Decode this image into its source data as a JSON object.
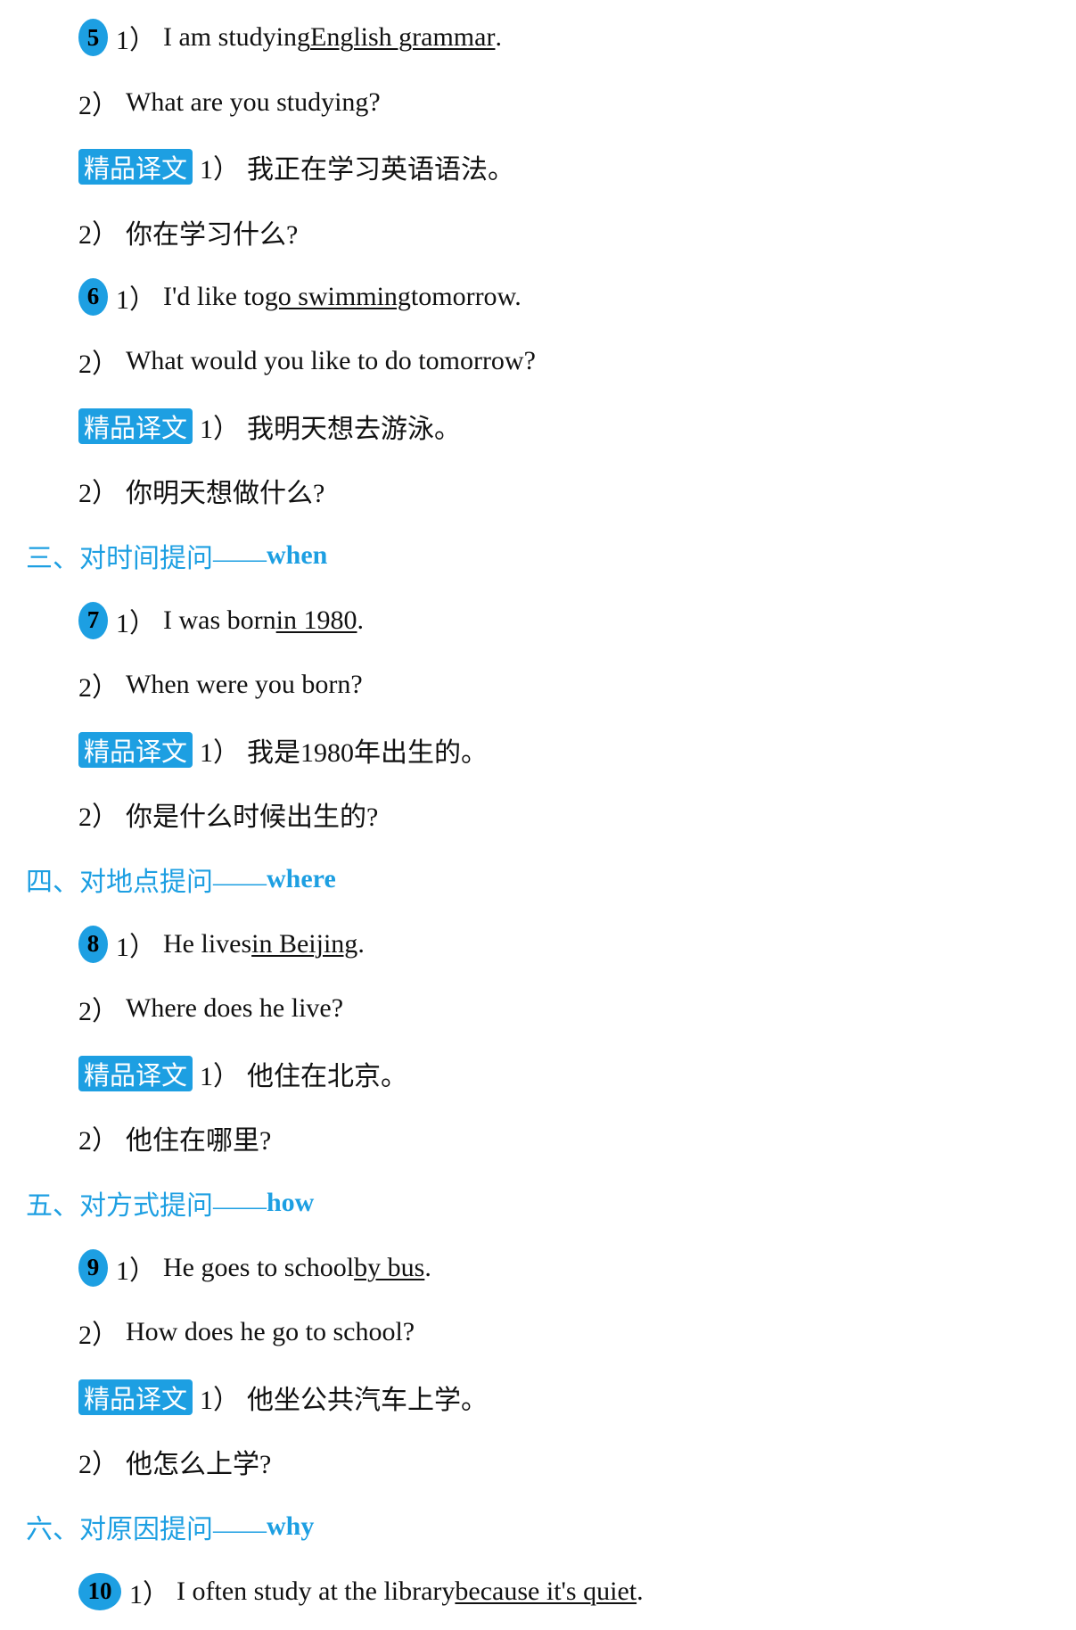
{
  "colors": {
    "accent": "#1d9fe2",
    "text": "#111111",
    "tag_text": "#ffffff"
  },
  "headings": [
    {
      "label": "三、对时间提问——",
      "keyword": "when"
    },
    {
      "label": "四、对地点提问——",
      "keyword": "where"
    },
    {
      "label": "五、对方式提问——",
      "keyword": "how"
    },
    {
      "label": "六、对原因提问——",
      "keyword": "why"
    }
  ],
  "items": [
    {
      "num": "5",
      "en1": {
        "prefix": "1）",
        "before": "I am studying ",
        "underline": "English grammar",
        "after": "."
      },
      "en2": {
        "prefix": "2）",
        "text": "What are you studying?"
      },
      "translation": {
        "tag": "精品译文",
        "zh1": {
          "prefix": "1）",
          "text": "我正在学习英语语法。"
        },
        "zh2": {
          "prefix": "2）",
          "text": "你在学习什么?"
        }
      }
    },
    {
      "num": "6",
      "en1": {
        "prefix": "1）",
        "before": "I'd like to ",
        "underline": "go swimming",
        "after": " tomorrow."
      },
      "en2": {
        "prefix": "2）",
        "text": "What would you like to do tomorrow?"
      },
      "translation": {
        "tag": "精品译文",
        "zh1": {
          "prefix": "1）",
          "text": "我明天想去游泳。"
        },
        "zh2": {
          "prefix": "2）",
          "text": "你明天想做什么?"
        }
      }
    },
    {
      "num": "7",
      "en1": {
        "prefix": "1）",
        "before": "I was born ",
        "underline": "in 1980",
        "after": "."
      },
      "en2": {
        "prefix": "2）",
        "text": "When were you born?"
      },
      "translation": {
        "tag": "精品译文",
        "zh1": {
          "prefix": "1）",
          "text": "我是1980年出生的。"
        },
        "zh2": {
          "prefix": "2）",
          "text": "你是什么时候出生的?"
        }
      }
    },
    {
      "num": "8",
      "en1": {
        "prefix": "1）",
        "before": "He lives ",
        "underline": "in Beijing",
        "after": "."
      },
      "en2": {
        "prefix": "2）",
        "text": "Where does he live?"
      },
      "translation": {
        "tag": "精品译文",
        "zh1": {
          "prefix": "1）",
          "text": "他住在北京。"
        },
        "zh2": {
          "prefix": "2）",
          "text": "他住在哪里?"
        }
      }
    },
    {
      "num": "9",
      "en1": {
        "prefix": "1）",
        "before": "He goes to school ",
        "underline": "by bus",
        "after": "."
      },
      "en2": {
        "prefix": "2）",
        "text": "How does he go to school?"
      },
      "translation": {
        "tag": "精品译文",
        "zh1": {
          "prefix": "1）",
          "text": "他坐公共汽车上学。"
        },
        "zh2": {
          "prefix": "2）",
          "text": "他怎么上学?"
        }
      }
    },
    {
      "num": "10",
      "en1": {
        "prefix": "1）",
        "before": "I often study at the library ",
        "underline": "because it's quiet",
        "after": "."
      }
    }
  ]
}
